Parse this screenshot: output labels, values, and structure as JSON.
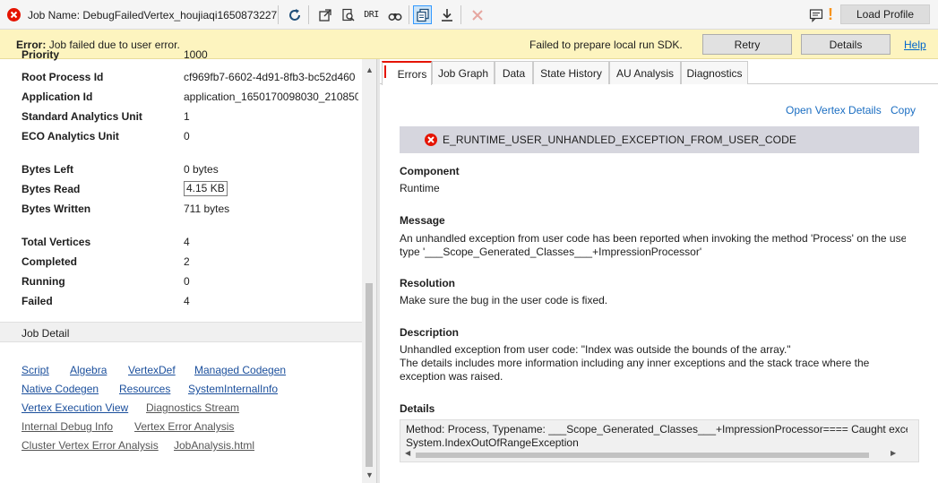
{
  "toolbar": {
    "job_name_label": "Job Name:",
    "job_name": "DebugFailedVertex_houjiaqi1650873227",
    "dri_label": "DRI",
    "load_profile_label": "Load Profile",
    "warning_glyph": "!",
    "icons": [
      "error-icon",
      "refresh-icon",
      "open-external-icon",
      "search-document-icon",
      "dri-icon",
      "binoculars-icon",
      "copy-job-icon",
      "download-icon",
      "cancel-icon",
      "feedback-icon",
      "warning-icon"
    ]
  },
  "error_bar": {
    "prefix": "Error:",
    "message": "Job failed due to user error.",
    "right_message": "Failed to prepare local run SDK.",
    "retry_label": "Retry",
    "details_label": "Details",
    "help_label": "Help"
  },
  "properties": [
    {
      "key": "Priority",
      "value": "1000"
    },
    {
      "key": "Root Process Id",
      "value": "cf969fb7-6602-4d91-8fb3-bc52d460"
    },
    {
      "key": "Application Id",
      "value": "application_1650170098030_210850"
    },
    {
      "key": "Standard Analytics Unit",
      "value": "1"
    },
    {
      "key": "ECO Analytics Unit",
      "value": "0"
    },
    {
      "key": "Bytes Left",
      "value": "0 bytes"
    },
    {
      "key": "Bytes Read",
      "value": "4.15 KB"
    },
    {
      "key": "Bytes Written",
      "value": "711 bytes"
    },
    {
      "key": "Total Vertices",
      "value": "4"
    },
    {
      "key": "Completed",
      "value": "2"
    },
    {
      "key": "Running",
      "value": "0"
    },
    {
      "key": "Failed",
      "value": "4"
    }
  ],
  "job_detail": {
    "title": "Job Detail",
    "links": [
      "Script",
      "Algebra",
      "VertexDef",
      "Managed Codegen",
      "Native Codegen",
      "Resources",
      "SystemInternalInfo",
      "Vertex Execution View",
      "Diagnostics Stream",
      "Internal Debug Info",
      "Vertex Error Analysis",
      "Cluster Vertex Error Analysis",
      "JobAnalysis.html"
    ]
  },
  "tabs": [
    "Errors",
    "Job Graph",
    "Data",
    "State History",
    "AU Analysis",
    "Diagnostics"
  ],
  "error_panel": {
    "open_vertex_details": "Open Vertex Details",
    "copy": "Copy",
    "error_code": "E_RUNTIME_USER_UNHANDLED_EXCEPTION_FROM_USER_CODE",
    "component_label": "Component",
    "component": "Runtime",
    "message_label": "Message",
    "message_line1": "An unhandled exception from user code has been reported when invoking the method 'Process' on the use",
    "message_line2": "type '___Scope_Generated_Classes___+ImpressionProcessor'",
    "resolution_label": "Resolution",
    "resolution": "Make sure the bug in the user code is fixed.",
    "description_label": "Description",
    "description_line1": "Unhandled exception from user code: \"Index was outside the bounds of the array.\"",
    "description_line2": "The details includes more information including any inner exceptions and the stack trace where the",
    "description_line3": "exception was raised.",
    "details_label": "Details",
    "details_line1": "Method: Process, Typename: ___Scope_Generated_Classes___+ImpressionProcessor==== Caught exceptio",
    "details_line2": "System.IndexOutOfRangeException"
  },
  "colors": {
    "error_red": "#e51400",
    "error_bar_bg": "#fdf4bf",
    "link_blue": "#1b4f9c",
    "banner_gray": "#d6d6de"
  }
}
